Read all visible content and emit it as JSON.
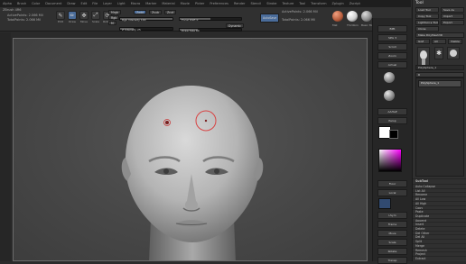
{
  "menubar": [
    "Alpha",
    "Brush",
    "Color",
    "Document",
    "Draw",
    "Edit",
    "File",
    "Layer",
    "Light",
    "Macro",
    "Marker",
    "Material",
    "Movie",
    "Picker",
    "Preferences",
    "Render",
    "Stencil",
    "Stroke",
    "Texture",
    "Tool",
    "Transform",
    "Zplugin",
    "Zscript"
  ],
  "info": {
    "line1": "ZBrush 4R6",
    "line2": "ActivePoints: 2.066 Mil",
    "line3": "TotalPoints: 2.066 Mil"
  },
  "topbar": {
    "tools": [
      {
        "name": "edit",
        "icon": "✎",
        "label": "Edit"
      },
      {
        "name": "draw",
        "icon": "✏",
        "label": "Draw"
      },
      {
        "name": "move",
        "icon": "✥",
        "label": "Move"
      },
      {
        "name": "scale",
        "icon": "⤢",
        "label": "Scale"
      },
      {
        "name": "rotate",
        "icon": "⟳",
        "label": "Rotate"
      }
    ],
    "mrgb": "Mrgb",
    "rgb": "Rgb",
    "m": "M",
    "zadd": "Zadd",
    "zsub": "Zsub",
    "zcut": "Zcut",
    "rgb_intensity": "Rgb Intensity 100",
    "z_intensity": "Z Intensity 25",
    "focal_shift": "Focal Shift 0",
    "draw_size": "Draw Size 64",
    "dynamic": "Dynamic",
    "active_points": "ActivePoints: 2.066 Mil",
    "total_points": "TotalPoints: 2.066 Mil",
    "autosave": "AutoSave",
    "mat_labels": [
      "Mat",
      "ThinSkin",
      "Basic Mat"
    ],
    "colors": {
      "mat1": "#b55a3a",
      "mat2": "#d0d0d0",
      "mat3": "#8f8f8f"
    }
  },
  "shelf": {
    "buttons": [
      "BPR",
      "SPix 3",
      "Scroll",
      "Zoom",
      "Actual",
      "AAHalf",
      "Persp",
      "Floor",
      "Local",
      "LSym",
      "Frame",
      "Move",
      "Scale",
      "Rotate",
      "Transp"
    ],
    "colors": {
      "main": "#ffffff",
      "secondary": "#000000"
    }
  },
  "tray": {
    "title": "Tool",
    "btns": [
      "Load Tool",
      "Save As",
      "Copy Tool",
      "Import",
      "Export",
      "Clone",
      "Make PolyMesh3D",
      "GoZ",
      "All",
      "Visible",
      "R",
      "Lightbox ▸ Tools"
    ],
    "current_tool": "PolySphere_1",
    "subtool": "SubTool",
    "subtool_item": "PolySphere_1",
    "rows": [
      "Auto Collapse",
      "List All",
      "Rename",
      "All Low",
      "All High",
      "Copy",
      "Paste",
      "Duplicate",
      "Append",
      "Insert",
      "Delete",
      "Del Other",
      "Del All",
      "Split",
      "Merge",
      "Remesh",
      "Project",
      "Extract"
    ]
  }
}
